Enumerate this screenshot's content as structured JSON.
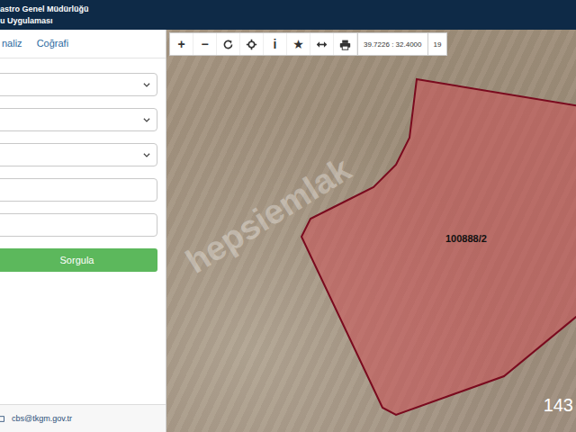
{
  "header": {
    "line1": "astro Genel Müdürlüğü",
    "line2": "u Uygulaması"
  },
  "tabs": [
    {
      "label": "naliz"
    },
    {
      "label": "Coğrafi"
    }
  ],
  "form": {
    "fields": [
      {
        "kind": "select"
      },
      {
        "kind": "select"
      },
      {
        "kind": "select"
      },
      {
        "kind": "input"
      },
      {
        "kind": "input"
      }
    ],
    "button": "Sorgula"
  },
  "footer": {
    "email": "cbs@tkgm.gov.tr"
  },
  "toolbar": {
    "buttons": [
      {
        "kind": "glyph",
        "label": "+"
      },
      {
        "kind": "glyph",
        "label": "−"
      },
      {
        "kind": "icon"
      },
      {
        "kind": "icon"
      },
      {
        "kind": "glyph",
        "label": "i"
      },
      {
        "kind": "glyph",
        "label": "★"
      },
      {
        "kind": "icon"
      },
      {
        "kind": "icon"
      }
    ],
    "coordinates": "39.7226 : 32.4000",
    "zoom": "19"
  },
  "map": {
    "parcel_label": "100888/2",
    "watermark": "hepsiemlak",
    "corner_text": "143"
  }
}
